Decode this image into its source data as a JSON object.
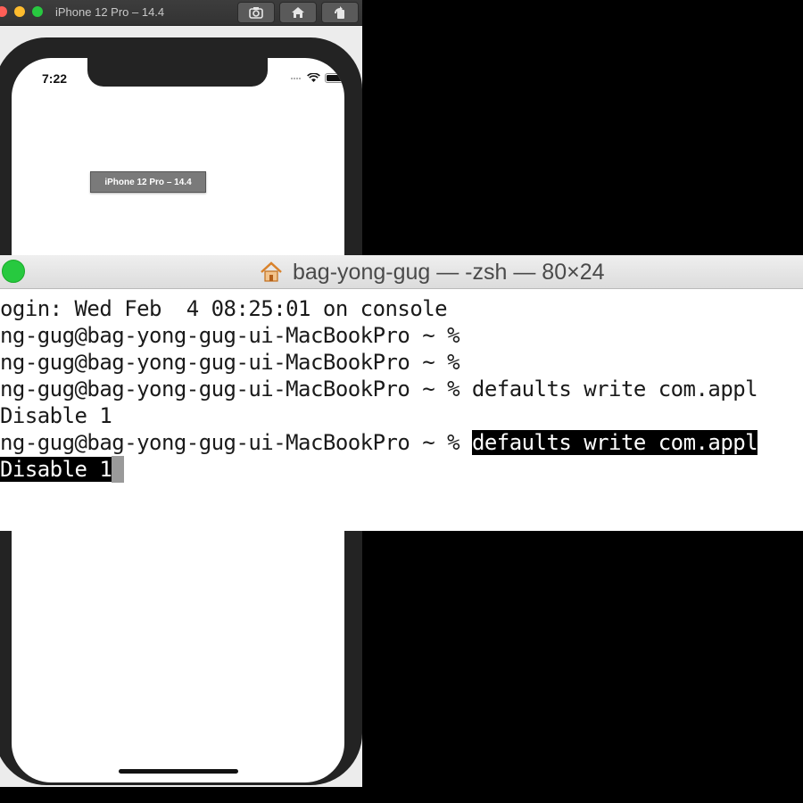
{
  "simulator": {
    "title": "iPhone 12 Pro – 14.4",
    "toolbar": [
      "screenshot-icon",
      "home-icon",
      "rotate-icon"
    ],
    "status_time": "7:22",
    "tooltip": "iPhone 12 Pro – 14.4"
  },
  "terminal": {
    "title": "bag-yong-gug — -zsh — 80×24",
    "lines": [
      {
        "text": "ogin: Wed Feb  4 08:25:01 on console"
      },
      {
        "text": "ng-gug@bag-yong-gug-ui-MacBookPro ~ %"
      },
      {
        "text": "ng-gug@bag-yong-gug-ui-MacBookPro ~ %"
      },
      {
        "text": "ng-gug@bag-yong-gug-ui-MacBookPro ~ % defaults write com.appl"
      },
      {
        "text": "Disable 1"
      },
      {
        "prompt": "ng-gug@bag-yong-gug-ui-MacBookPro ~ % ",
        "selected": "defaults write com.appl"
      },
      {
        "selected": "Disable 1"
      }
    ]
  },
  "colors": {
    "terminal_selection": "#000000",
    "traffic_close": "#ff5f57",
    "traffic_minimize": "#febc2e",
    "traffic_zoom": "#28c840"
  }
}
